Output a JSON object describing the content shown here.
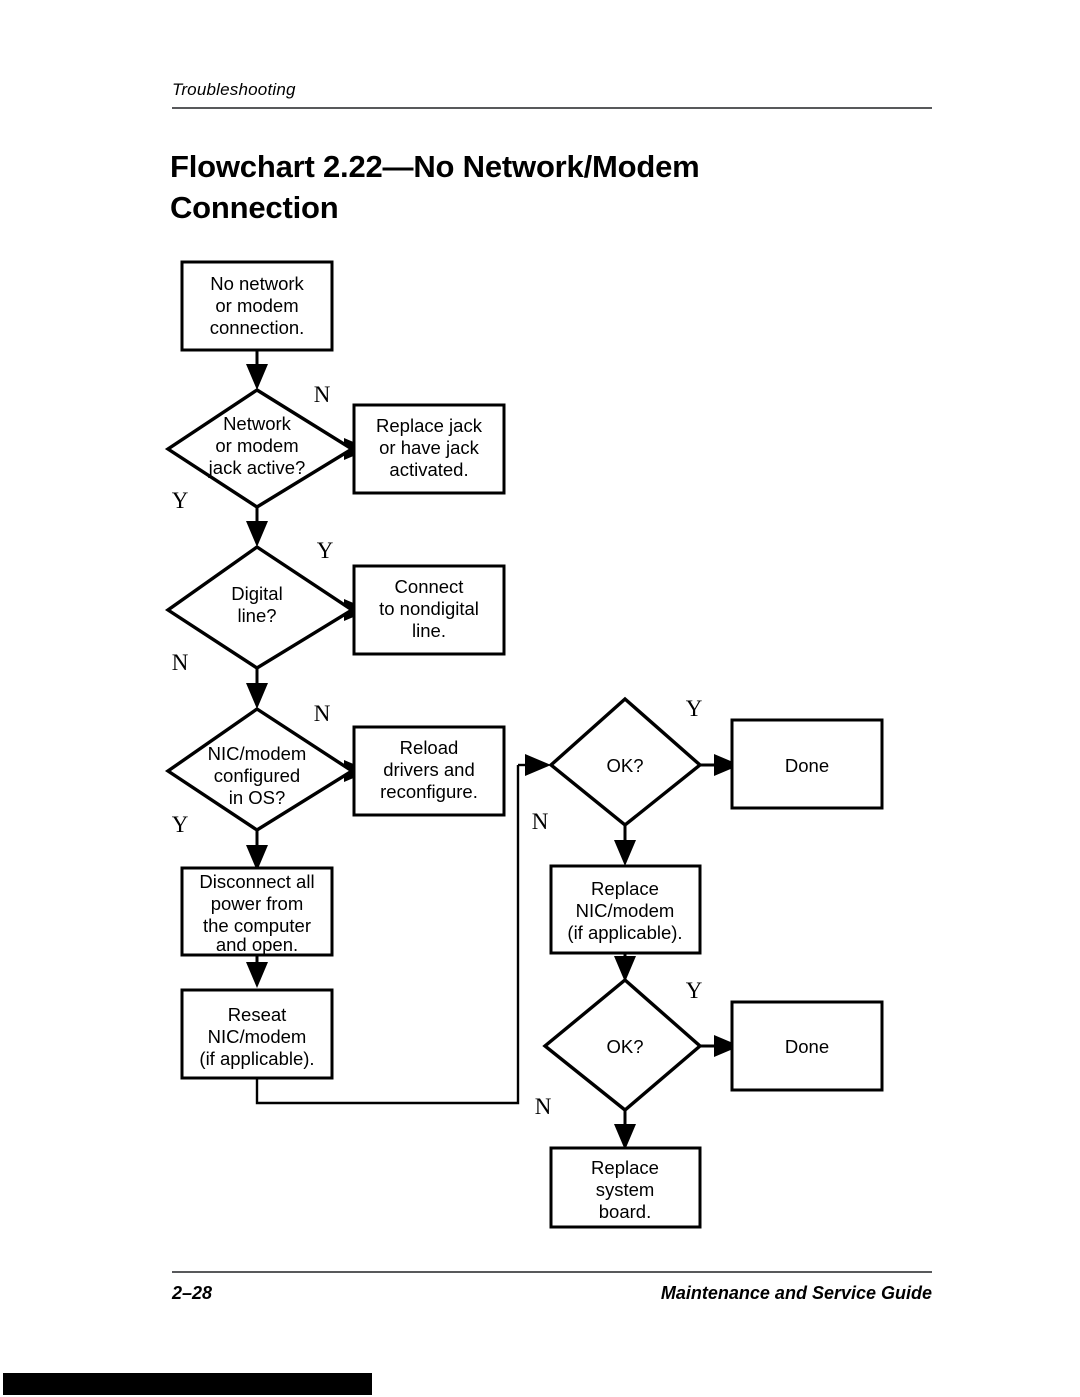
{
  "header": {
    "running_head": "Troubleshooting"
  },
  "title": {
    "line1": "Flowchart 2.22—No Network/Modem",
    "line2": "Connection"
  },
  "footer": {
    "page_number": "2–28",
    "guide_title": "Maintenance and Service Guide"
  },
  "flowchart": {
    "nodes": {
      "start": {
        "type": "process",
        "line1": "No network",
        "line2": "or modem",
        "line3": "connection."
      },
      "jack_active": {
        "type": "decision",
        "line1": "Network",
        "line2": "or modem",
        "line3": "jack active?"
      },
      "replace_jack": {
        "type": "process",
        "line1": "Replace jack",
        "line2": "or have jack",
        "line3": "activated."
      },
      "digital_line": {
        "type": "decision",
        "line1": "Digital",
        "line2": "line?"
      },
      "connect_nondigital": {
        "type": "process",
        "line1": "Connect",
        "line2": "to nondigital",
        "line3": "line."
      },
      "nic_configured": {
        "type": "decision",
        "line1": "NIC/modem",
        "line2": "configured",
        "line3": "in OS?"
      },
      "reload_drivers": {
        "type": "process",
        "line1": "Reload",
        "line2": "drivers and",
        "line3": "reconfigure."
      },
      "ok_1": {
        "type": "decision",
        "line1": "OK?"
      },
      "done_1": {
        "type": "process",
        "line1": "Done"
      },
      "disconnect_power": {
        "type": "process",
        "line1": "Disconnect all",
        "line2": "power from",
        "line3": "the computer",
        "line4": "and open."
      },
      "reseat_nic": {
        "type": "process",
        "line1": "Reseat",
        "line2": "NIC/modem",
        "line3": "(if applicable)."
      },
      "replace_nic": {
        "type": "process",
        "line1": "Replace",
        "line2": "NIC/modem",
        "line3": "(if applicable)."
      },
      "ok_2": {
        "type": "decision",
        "line1": "OK?"
      },
      "done_2": {
        "type": "process",
        "line1": "Done"
      },
      "replace_board": {
        "type": "process",
        "line1": "Replace",
        "line2": "system",
        "line3": "board."
      }
    },
    "branch_labels": {
      "jack_no": "N",
      "jack_yes": "Y",
      "digital_yes": "Y",
      "digital_no": "N",
      "nic_no": "N",
      "nic_yes": "Y",
      "ok1_yes": "Y",
      "ok1_no": "N",
      "ok2_yes": "Y",
      "ok2_no": "N"
    }
  }
}
